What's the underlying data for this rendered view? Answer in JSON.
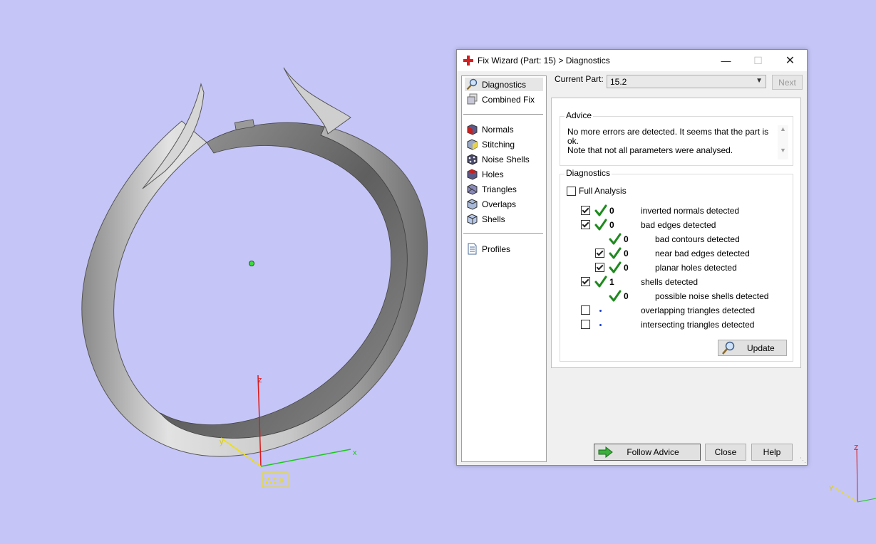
{
  "viewport": {
    "wcs_label": "WCS",
    "axis_x": "x",
    "axis_y": "y",
    "axis_z": "z",
    "mini_axis_z": "Z",
    "mini_axis_y": "Y"
  },
  "dialog": {
    "title": "Fix Wizard (Part: 15) > Diagnostics",
    "window_buttons": {
      "minimize": "—",
      "maximize": "☐",
      "close": "✕"
    },
    "nav": {
      "top": [
        {
          "label": "Diagnostics",
          "icon": "magnifier-icon",
          "selected": true
        },
        {
          "label": "Combined Fix",
          "icon": "combined-fix-icon"
        }
      ],
      "tools": [
        {
          "label": "Normals",
          "icon": "normals-cube-icon"
        },
        {
          "label": "Stitching",
          "icon": "stitching-cube-icon"
        },
        {
          "label": "Noise Shells",
          "icon": "noise-shells-icon"
        },
        {
          "label": "Holes",
          "icon": "holes-cube-icon"
        },
        {
          "label": "Triangles",
          "icon": "triangles-cube-icon"
        },
        {
          "label": "Overlaps",
          "icon": "overlaps-cube-icon"
        },
        {
          "label": "Shells",
          "icon": "shells-cube-icon"
        }
      ],
      "bottom": [
        {
          "label": "Profiles",
          "icon": "document-icon"
        }
      ]
    },
    "current_part_label": "Current Part:",
    "current_part_value": "15.2",
    "next_label": "Next",
    "advice": {
      "title": "Advice",
      "line1": "No more errors are detected. It seems that the part is ok.",
      "line2": "Note that not all parameters were analysed."
    },
    "diagnostics": {
      "title": "Diagnostics",
      "full_analysis_label": "Full Analysis",
      "full_analysis_checked": false,
      "rows": [
        {
          "checkbox": true,
          "checked": true,
          "status": "ok",
          "count": "0",
          "label": "inverted normals detected",
          "indent": 0
        },
        {
          "checkbox": true,
          "checked": true,
          "status": "ok",
          "count": "0",
          "label": "bad edges detected",
          "indent": 0
        },
        {
          "checkbox": false,
          "checked": false,
          "status": "ok",
          "count": "0",
          "label": "bad contours detected",
          "indent": 1
        },
        {
          "checkbox": true,
          "checked": true,
          "status": "ok",
          "count": "0",
          "label": "near bad edges detected",
          "indent": 1
        },
        {
          "checkbox": true,
          "checked": true,
          "status": "ok",
          "count": "0",
          "label": "planar holes detected",
          "indent": 1
        },
        {
          "checkbox": true,
          "checked": true,
          "status": "ok",
          "count": "1",
          "label": "shells detected",
          "indent": 0
        },
        {
          "checkbox": false,
          "checked": false,
          "status": "ok",
          "count": "0",
          "label": "possible noise shells detected",
          "indent": 1
        },
        {
          "checkbox": true,
          "checked": false,
          "status": "pending",
          "count": "",
          "label": "overlapping triangles detected",
          "indent": 0
        },
        {
          "checkbox": true,
          "checked": false,
          "status": "pending",
          "count": "",
          "label": "intersecting triangles detected",
          "indent": 0
        }
      ],
      "update_label": "Update"
    },
    "buttons": {
      "follow_advice": "Follow Advice",
      "close": "Close",
      "help": "Help"
    },
    "colors": {
      "background": "#c5c5f7",
      "check_green": "#1f8a1f",
      "pending_dot": "#1a3fc9",
      "title_icon_red": "#d42020"
    }
  }
}
